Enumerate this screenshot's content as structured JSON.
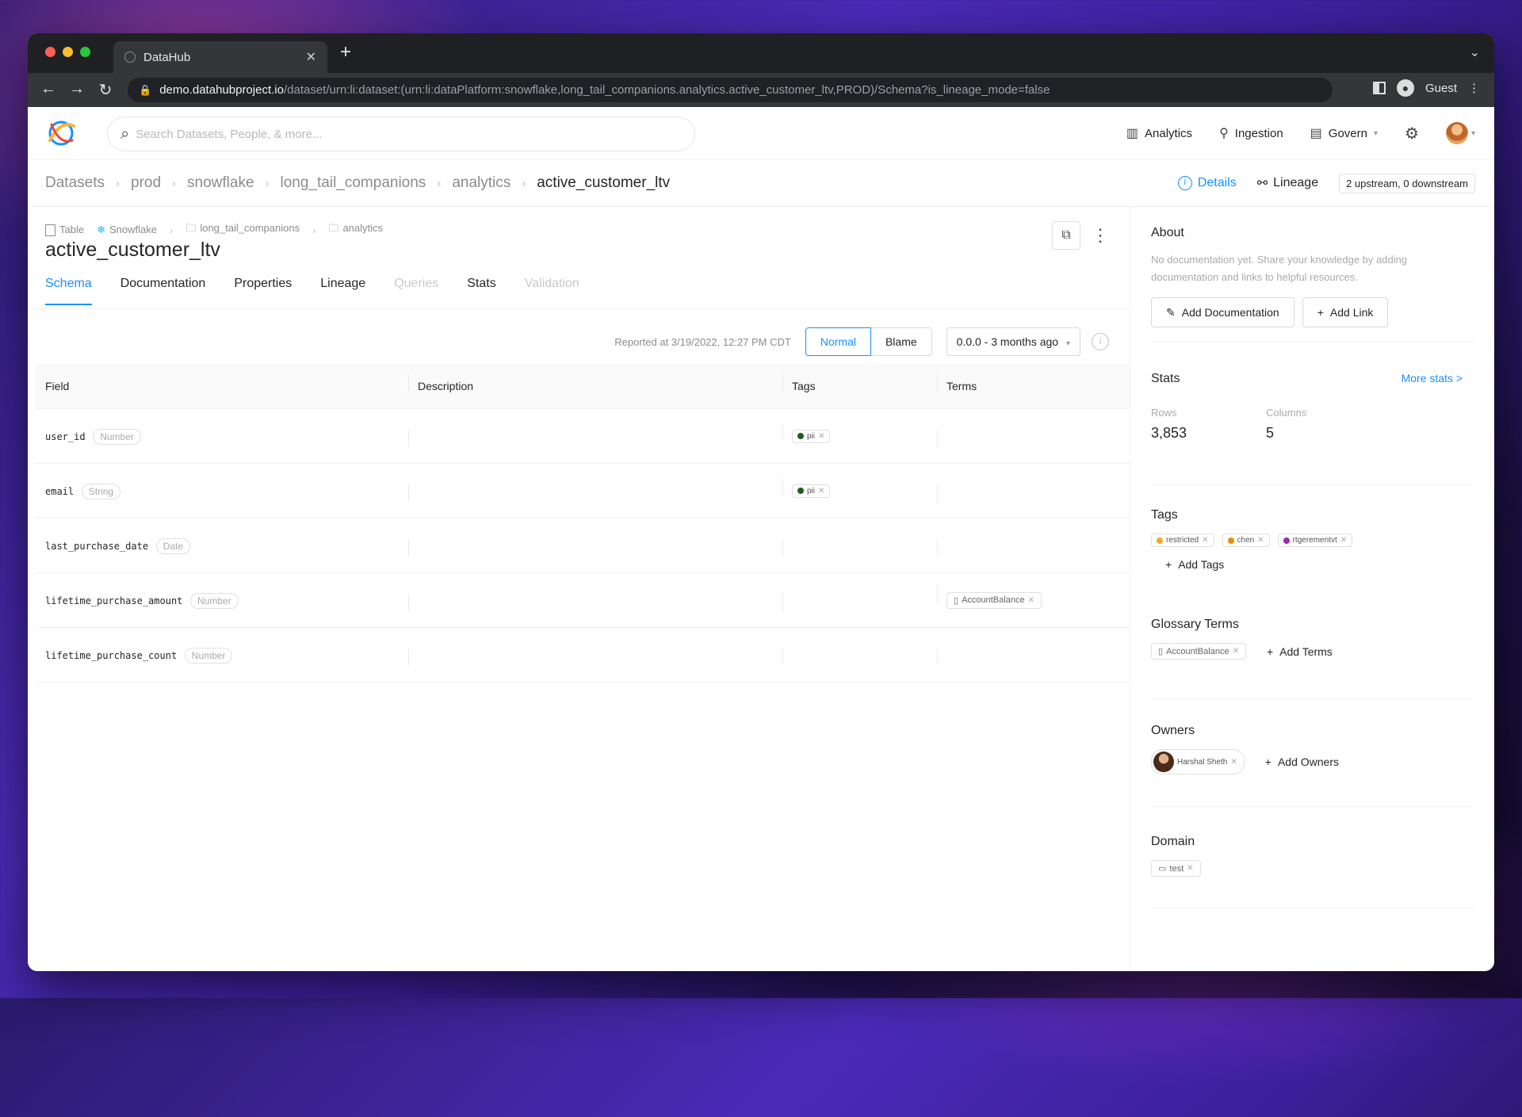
{
  "browser": {
    "tab_title": "DataHub",
    "url_host": "demo.datahubproject.io",
    "url_path": "/dataset/urn:li:dataset:(urn:li:dataPlatform:snowflake,long_tail_companions.analytics.active_customer_ltv,PROD)/Schema?is_lineage_mode=false",
    "profile": "Guest"
  },
  "header": {
    "search_placeholder": "Search Datasets, People, & more...",
    "menu": {
      "analytics": "Analytics",
      "ingestion": "Ingestion",
      "govern": "Govern"
    }
  },
  "breadcrumbs": [
    "Datasets",
    "prod",
    "snowflake",
    "long_tail_companions",
    "analytics",
    "active_customer_ltv"
  ],
  "crumb_right": {
    "details": "Details",
    "lineage": "Lineage",
    "upstream": "2 upstream, 0 downstream"
  },
  "entity": {
    "type": "Table",
    "platform": "Snowflake",
    "path": [
      "long_tail_companions",
      "analytics"
    ],
    "title": "active_customer_ltv"
  },
  "tabs": [
    "Schema",
    "Documentation",
    "Properties",
    "Lineage",
    "Queries",
    "Stats",
    "Validation"
  ],
  "schema_toolbar": {
    "reported": "Reported at 3/19/2022, 12:27 PM CDT",
    "normal": "Normal",
    "blame": "Blame",
    "version": "0.0.0 - 3 months ago"
  },
  "table": {
    "headers": [
      "Field",
      "Description",
      "Tags",
      "Terms"
    ],
    "rows": [
      {
        "field": "user_id",
        "type": "Number",
        "tag": "pii",
        "term": ""
      },
      {
        "field": "email",
        "type": "String",
        "tag": "pii",
        "term": ""
      },
      {
        "field": "last_purchase_date",
        "type": "Date",
        "tag": "",
        "term": ""
      },
      {
        "field": "lifetime_purchase_amount",
        "type": "Number",
        "tag": "",
        "term": "AccountBalance"
      },
      {
        "field": "lifetime_purchase_count",
        "type": "Number",
        "tag": "",
        "term": ""
      }
    ]
  },
  "sidebar": {
    "about_title": "About",
    "about_text": "No documentation yet. Share your knowledge by adding documentation and links to helpful resources.",
    "add_documentation": "Add Documentation",
    "add_link": "Add Link",
    "stats_title": "Stats",
    "more_stats": "More stats >",
    "rows_label": "Rows",
    "rows_value": "3,853",
    "columns_label": "Columns",
    "columns_value": "5",
    "tags_title": "Tags",
    "tags": [
      {
        "name": "restricted",
        "color": "#f5a623"
      },
      {
        "name": "chen",
        "color": "#f08c00"
      },
      {
        "name": "rtgerementvt",
        "color": "#9c27b0"
      }
    ],
    "add_tags": "Add Tags",
    "glossary_title": "Glossary Terms",
    "glossary_term": "AccountBalance",
    "add_terms": "Add Terms",
    "owners_title": "Owners",
    "owner": "Harshal Sheth",
    "add_owners": "Add Owners",
    "domain_title": "Domain",
    "domain": "test"
  },
  "colors": {
    "accent": "#1890ff",
    "pii_dot": "#1b5e20"
  }
}
